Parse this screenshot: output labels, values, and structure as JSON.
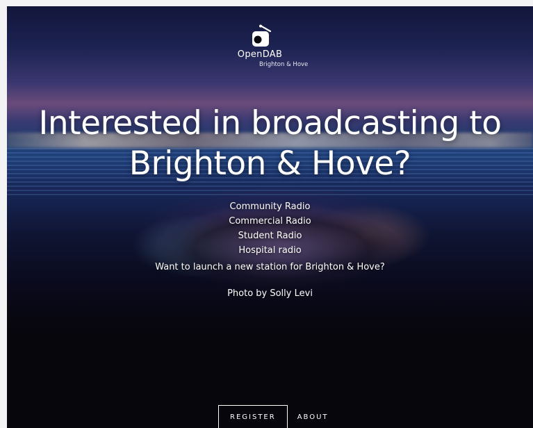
{
  "brand": {
    "name": "OpenDAB",
    "location": "Brighton & Hove",
    "icon": "radio-icon"
  },
  "hero": {
    "headline_line1": "Interested in broadcasting to",
    "headline_line2": "Brighton & Hove?",
    "station_types": [
      "Community Radio",
      "Commercial Radio",
      "Student Radio",
      "Hospital radio"
    ],
    "launch_prompt": "Want to launch a new station for Brighton & Hove?",
    "photo_credit": "Photo by Solly Levi"
  },
  "nav": {
    "register_label": "REGISTER",
    "about_label": "ABOUT"
  },
  "colors": {
    "text": "#ffffff",
    "background": "#07060c",
    "sky": "#1d2352"
  }
}
